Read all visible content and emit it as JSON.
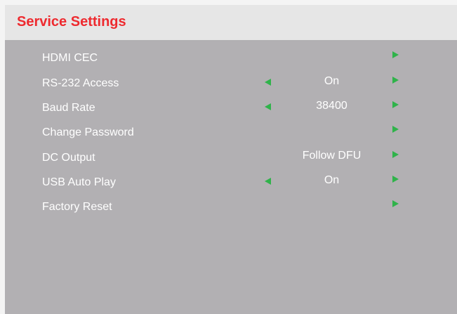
{
  "header": {
    "title": "Service Settings"
  },
  "menu": {
    "items": [
      {
        "label": "HDMI CEC",
        "value": "",
        "has_left_arrow": false,
        "has_right_arrow": true
      },
      {
        "label": "RS-232 Access",
        "value": "On",
        "has_left_arrow": true,
        "has_right_arrow": true
      },
      {
        "label": "Baud Rate",
        "value": "38400",
        "has_left_arrow": true,
        "has_right_arrow": true
      },
      {
        "label": "Change Password",
        "value": "",
        "has_left_arrow": false,
        "has_right_arrow": true
      },
      {
        "label": "DC Output",
        "value": "Follow DFU",
        "has_left_arrow": false,
        "has_right_arrow": true
      },
      {
        "label": "USB Auto Play",
        "value": "On",
        "has_left_arrow": true,
        "has_right_arrow": true
      },
      {
        "label": "Factory Reset",
        "value": "",
        "has_left_arrow": false,
        "has_right_arrow": true
      }
    ]
  },
  "colors": {
    "title": "#ee2a2f",
    "header_bg": "#e6e6e6",
    "panel_bg": "#b2b0b3",
    "text": "#ffffff",
    "arrow": "#2fb34a"
  },
  "icons": {
    "left_arrow": "triangle-left-icon",
    "right_arrow": "triangle-right-icon"
  }
}
